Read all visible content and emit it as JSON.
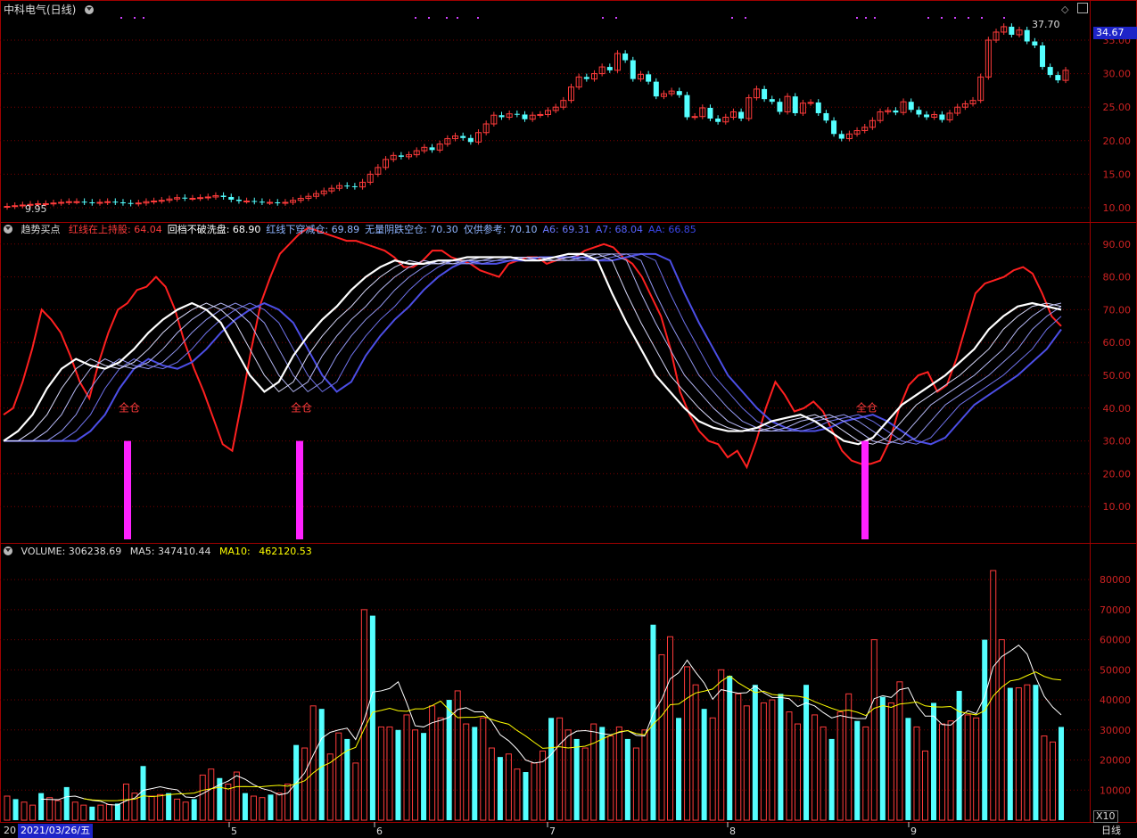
{
  "window": {
    "title": "中科电气(日线)",
    "last_price": "34.67",
    "high_label": "37.70",
    "low_label": "9.95",
    "colors": {
      "up": "#ff3b3b",
      "down": "#54ffff",
      "grid": "#7a0000",
      "frame": "#a00000"
    }
  },
  "indicator_header": {
    "name": "趋势买点",
    "items": [
      {
        "label": "红线在上持股",
        "value": "64.04",
        "color": "#ff3b3b"
      },
      {
        "label": "回档不破洗盘",
        "value": "68.90",
        "color": "#ffffff"
      },
      {
        "label": "红线下穿减仓",
        "value": "69.89",
        "color": "#8fb4ff"
      },
      {
        "label": "无量阴跌空仓",
        "value": "70.30",
        "color": "#8fb4ff"
      },
      {
        "label": "仅供参考",
        "value": "70.10",
        "color": "#8fb4ff"
      },
      {
        "label": "A6",
        "value": "69.31",
        "color": "#6a78ff"
      },
      {
        "label": "A7",
        "value": "68.04",
        "color": "#5561ff"
      },
      {
        "label": "AA",
        "value": "66.85",
        "color": "#3a46e8"
      }
    ],
    "full_position_label": "全仓"
  },
  "volume_header": {
    "name": "VOLUME",
    "value": "306238.69",
    "ma5_label": "MA5",
    "ma5": "347410.44",
    "ma10_label": "MA10",
    "ma10": "462120.53"
  },
  "bottom_bar": {
    "left_label": "20",
    "date": "2021/03/26/五",
    "period": "日线",
    "volume_unit": "X10"
  },
  "chart_data": {
    "type": "candlestick",
    "x_ticks": [
      "5",
      "6",
      "7",
      "8",
      "9"
    ],
    "price_axis": {
      "ticks": [
        "35.00",
        "30.00",
        "25.00",
        "20.00",
        "15.00",
        "10.00"
      ]
    },
    "indicator_axis": {
      "ticks": [
        "90.00",
        "80.00",
        "70.00",
        "60.00",
        "50.00",
        "40.00",
        "30.00",
        "20.00",
        "10.00"
      ]
    },
    "volume_axis": {
      "ticks": [
        "80000",
        "70000",
        "60000",
        "50000",
        "40000",
        "30000",
        "20000",
        "10000"
      ]
    },
    "price_close": [
      10.2,
      10.3,
      10.4,
      10.5,
      10.6,
      10.6,
      10.7,
      10.8,
      10.9,
      10.9,
      10.8,
      10.7,
      10.8,
      10.9,
      10.8,
      10.7,
      10.6,
      10.7,
      10.9,
      11,
      11.1,
      11.3,
      11.5,
      11.4,
      11.4,
      11.5,
      11.6,
      11.8,
      11.6,
      11.2,
      11,
      11,
      10.9,
      10.8,
      10.8,
      10.7,
      10.8,
      11.1,
      11.4,
      11.7,
      12.1,
      12.5,
      12.9,
      13.3,
      13.2,
      13.1,
      13.8,
      15,
      16,
      17.2,
      17.8,
      17.6,
      17.9,
      18.5,
      19,
      18.6,
      19.5,
      20.3,
      20.7,
      20.4,
      19.8,
      21.2,
      22.5,
      23.8,
      23.5,
      24,
      23.9,
      23.2,
      23.8,
      23.9,
      24.5,
      25,
      26,
      28,
      29.5,
      29.2,
      30,
      31,
      30.5,
      33,
      32,
      29.2,
      29.9,
      28.8,
      26.6,
      27,
      27.4,
      26.8,
      23.5,
      23.6,
      24.9,
      23.3,
      22.8,
      23.5,
      24.3,
      23.3,
      26.4,
      27.7,
      26.2,
      25.8,
      24.3,
      26.6,
      24.1,
      25.6,
      25.7,
      24.1,
      23,
      21,
      20.3,
      21,
      21.5,
      22,
      23,
      24.3,
      24.5,
      24.2,
      25.8,
      24.6,
      23.9,
      23.5,
      23.9,
      23.1,
      24.1,
      25,
      25.5,
      26,
      29.5,
      35,
      36.2,
      37,
      35.8,
      36.5,
      34.8,
      34.2,
      31,
      29.8,
      29,
      30.5
    ],
    "price_open": [
      10.1,
      10.2,
      10.3,
      10.4,
      10.5,
      10.6,
      10.6,
      10.7,
      10.8,
      10.9,
      10.9,
      10.8,
      10.7,
      10.8,
      10.9,
      10.8,
      10.7,
      10.6,
      10.7,
      10.9,
      11,
      11.1,
      11.3,
      11.5,
      11.4,
      11.4,
      11.5,
      11.6,
      11.8,
      11.6,
      11.2,
      11,
      11,
      10.9,
      10.8,
      10.8,
      10.7,
      10.8,
      11.1,
      11.4,
      11.7,
      12.1,
      12.5,
      12.9,
      13.3,
      13.2,
      13.1,
      13.8,
      15,
      16,
      17.2,
      17.8,
      17.6,
      17.9,
      18.5,
      19,
      18.6,
      19.5,
      20.3,
      20.7,
      20.4,
      19.8,
      21.2,
      22.5,
      23.8,
      23.5,
      24,
      23.9,
      23.2,
      23.8,
      23.9,
      24.5,
      25,
      26,
      28,
      29.5,
      29.2,
      30,
      31,
      30.5,
      33,
      32,
      29.2,
      29.9,
      28.8,
      26.6,
      27,
      27.4,
      26.8,
      23.5,
      23.6,
      24.9,
      23.3,
      22.8,
      23.5,
      24.3,
      23.3,
      26.4,
      27.7,
      26.2,
      25.8,
      24.3,
      26.6,
      24.1,
      25.6,
      25.7,
      24.1,
      23,
      21,
      20.3,
      21,
      21.5,
      22,
      23,
      24.3,
      24.5,
      24.2,
      25.8,
      24.6,
      23.9,
      23.5,
      23.9,
      23.1,
      24.1,
      25,
      25.5,
      26,
      29.5,
      35,
      36.2,
      37,
      35.8,
      36.5,
      34.8,
      34.2,
      31,
      29.8,
      29
    ],
    "volume": [
      8000,
      7000,
      6000,
      5000,
      9000,
      7500,
      6500,
      11000,
      6000,
      5000,
      4500,
      5000,
      5200,
      5500,
      12000,
      9000,
      18000,
      8000,
      8500,
      9000,
      7000,
      6000,
      7000,
      15000,
      17000,
      14000,
      12000,
      16000,
      9000,
      8000,
      7500,
      8500,
      9000,
      12000,
      25000,
      24000,
      38000,
      37000,
      22000,
      29000,
      27000,
      19000,
      70000,
      68000,
      31000,
      31000,
      30000,
      35000,
      30000,
      29000,
      38000,
      34000,
      40000,
      43000,
      32000,
      31000,
      34000,
      24000,
      21000,
      22000,
      17000,
      16000,
      19000,
      23000,
      34000,
      34000,
      30000,
      27000,
      24000,
      32000,
      31000,
      28000,
      31000,
      27000,
      24000,
      30000,
      65000,
      55000,
      61000,
      34000,
      51000,
      45000,
      37000,
      34000,
      50000,
      48000,
      42000,
      38000,
      45000,
      39000,
      40000,
      42000,
      36000,
      32000,
      45000,
      35000,
      31000,
      27000,
      36000,
      42000,
      33000,
      31000,
      60000,
      41000,
      39000,
      46000,
      34000,
      31000,
      23000,
      39000,
      32000,
      33000,
      43000,
      35000,
      34000,
      60000,
      83000,
      60000,
      44000,
      44000,
      45000,
      45000,
      28000,
      26000,
      31000
    ],
    "indicator_red": [
      38,
      40,
      48,
      58,
      70,
      67,
      63,
      56,
      48,
      43,
      54,
      63,
      70,
      72,
      76,
      77,
      80,
      77,
      70,
      60,
      52,
      45,
      37,
      29,
      27,
      42,
      58,
      72,
      80,
      87,
      90,
      93,
      95,
      94,
      93,
      92,
      91,
      91,
      90,
      89,
      88,
      86,
      83,
      83,
      85,
      88,
      88,
      86,
      85,
      84,
      82,
      81,
      80,
      84,
      85,
      86,
      86,
      84,
      85,
      86,
      86,
      88,
      89,
      90,
      89,
      86,
      84,
      80,
      74,
      68,
      58,
      45,
      38,
      33,
      30,
      29,
      25,
      27,
      22,
      30,
      40,
      48,
      44,
      39,
      40,
      42,
      39,
      33,
      27,
      24,
      23,
      23,
      24,
      30,
      40,
      47,
      50,
      51,
      45,
      47,
      55,
      65,
      75,
      78,
      79,
      80,
      82,
      83,
      81,
      75,
      68,
      65
    ],
    "indicator_white": [
      30,
      33,
      38,
      46,
      52,
      55,
      53,
      52,
      54,
      58,
      63,
      67,
      70,
      72,
      70,
      66,
      58,
      50,
      45,
      48,
      56,
      62,
      67,
      71,
      76,
      80,
      83,
      85,
      84,
      84,
      85,
      85,
      86,
      86,
      86,
      86,
      85,
      85,
      86,
      87,
      87,
      85,
      75,
      66,
      58,
      50,
      45,
      40,
      36,
      34,
      33,
      33,
      34,
      36,
      37,
      38,
      36,
      33,
      30,
      29,
      31,
      36,
      41,
      44,
      47,
      50,
      54,
      58,
      64,
      68,
      71,
      72,
      71,
      70
    ]
  }
}
